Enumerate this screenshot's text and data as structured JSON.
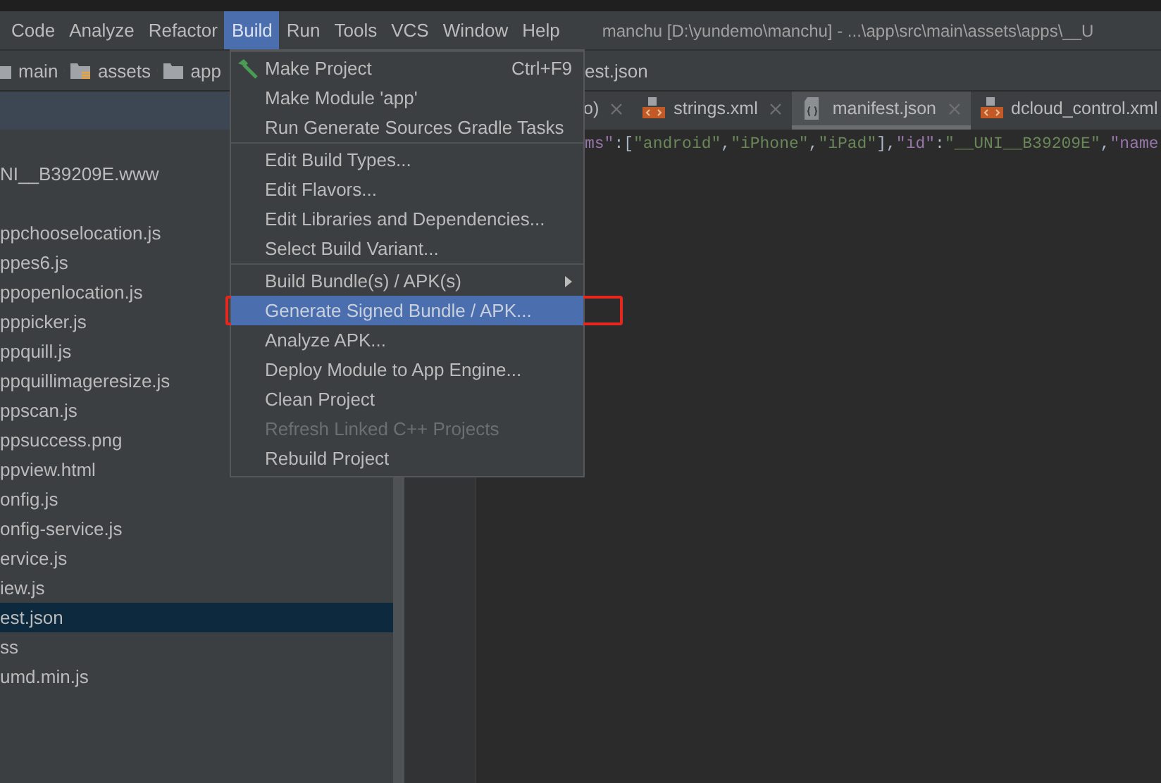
{
  "menubar": {
    "items": [
      {
        "label": "Code",
        "selected": false
      },
      {
        "label": "Analyze",
        "selected": false
      },
      {
        "label": "Refactor",
        "selected": false
      },
      {
        "label": "Build",
        "selected": true
      },
      {
        "label": "Run",
        "selected": false
      },
      {
        "label": "Tools",
        "selected": false
      },
      {
        "label": "VCS",
        "selected": false
      },
      {
        "label": "Window",
        "selected": false
      },
      {
        "label": "Help",
        "selected": false
      }
    ],
    "title": "manchu [D:\\yundemo\\manchu] - ...\\app\\src\\main\\assets\\apps\\__U"
  },
  "breadcrumbs": {
    "items": [
      {
        "label": "main"
      },
      {
        "label": "assets"
      },
      {
        "label": "app"
      }
    ],
    "tail": "est.json"
  },
  "project_tree": {
    "root": "NI__B39209E.www",
    "files": [
      {
        "label": "ppchooselocation.js",
        "selected": false
      },
      {
        "label": "ppes6.js",
        "selected": false
      },
      {
        "label": "ppopenlocation.js",
        "selected": false
      },
      {
        "label": "pppicker.js",
        "selected": false
      },
      {
        "label": "ppquill.js",
        "selected": false
      },
      {
        "label": "ppquillimageresize.js",
        "selected": false
      },
      {
        "label": "ppscan.js",
        "selected": false
      },
      {
        "label": "ppsuccess.png",
        "selected": false
      },
      {
        "label": "ppview.html",
        "selected": false
      },
      {
        "label": "onfig.js",
        "selected": false
      },
      {
        "label": "onfig-service.js",
        "selected": false
      },
      {
        "label": "ervice.js",
        "selected": false
      },
      {
        "label": "iew.js",
        "selected": false
      },
      {
        "label": "est.json",
        "selected": true
      },
      {
        "label": "ss",
        "selected": false
      },
      {
        "label": "umd.min.js",
        "selected": false
      }
    ]
  },
  "editor": {
    "tabs": [
      {
        "label": "o)",
        "selected": false,
        "closable": true
      },
      {
        "label": "strings.xml",
        "selected": false,
        "closable": true
      },
      {
        "label": "manifest.json",
        "selected": true,
        "closable": true
      },
      {
        "label": "dcloud_control.xml",
        "selected": false,
        "closable": false
      }
    ],
    "code_line": [
      {
        "text": "ms\"",
        "kind": "key"
      },
      {
        "text": ":[",
        "kind": "punct"
      },
      {
        "text": "\"android\"",
        "kind": "string"
      },
      {
        "text": ",",
        "kind": "punct"
      },
      {
        "text": "\"iPhone\"",
        "kind": "string"
      },
      {
        "text": ",",
        "kind": "punct"
      },
      {
        "text": "\"iPad\"",
        "kind": "string"
      },
      {
        "text": "],",
        "kind": "punct"
      },
      {
        "text": "\"id\"",
        "kind": "key"
      },
      {
        "text": ":",
        "kind": "punct"
      },
      {
        "text": "\"__UNI__B39209E\"",
        "kind": "string"
      },
      {
        "text": ",",
        "kind": "punct"
      },
      {
        "text": "\"name",
        "kind": "key"
      }
    ]
  },
  "build_menu": {
    "groups": [
      {
        "items": [
          {
            "label": "Make Project",
            "shortcut": "Ctrl+F9",
            "selected": false,
            "disabled": false,
            "submenu": false
          },
          {
            "label": "Make Module 'app'",
            "selected": false,
            "disabled": false,
            "submenu": false
          },
          {
            "label": "Run Generate Sources Gradle Tasks",
            "selected": false,
            "disabled": false,
            "submenu": false
          }
        ]
      },
      {
        "items": [
          {
            "label": "Edit Build Types...",
            "selected": false,
            "disabled": false,
            "submenu": false
          },
          {
            "label": "Edit Flavors...",
            "selected": false,
            "disabled": false,
            "submenu": false
          },
          {
            "label": "Edit Libraries and Dependencies...",
            "selected": false,
            "disabled": false,
            "submenu": false
          },
          {
            "label": "Select Build Variant...",
            "selected": false,
            "disabled": false,
            "submenu": false
          }
        ]
      },
      {
        "items": [
          {
            "label": "Build Bundle(s) / APK(s)",
            "selected": false,
            "disabled": false,
            "submenu": true
          },
          {
            "label": "Generate Signed Bundle / APK...",
            "selected": true,
            "disabled": false,
            "submenu": false,
            "annotated": true
          },
          {
            "label": "Analyze APK...",
            "selected": false,
            "disabled": false,
            "submenu": false
          },
          {
            "label": "Deploy Module to App Engine...",
            "selected": false,
            "disabled": false,
            "submenu": false
          },
          {
            "label": "Clean Project",
            "selected": false,
            "disabled": false,
            "submenu": false
          },
          {
            "label": "Refresh Linked C++ Projects",
            "selected": false,
            "disabled": true,
            "submenu": false
          },
          {
            "label": "Rebuild Project",
            "selected": false,
            "disabled": false,
            "submenu": false
          }
        ]
      }
    ]
  }
}
